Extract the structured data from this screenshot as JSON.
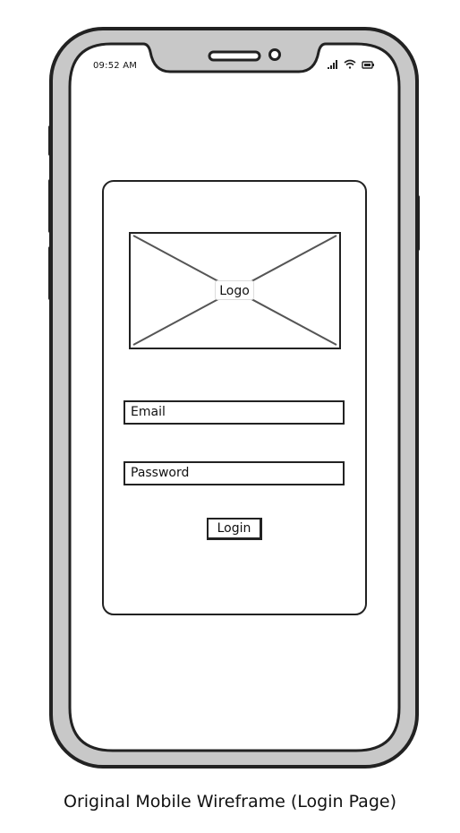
{
  "status_bar": {
    "time": "09:52 AM",
    "icons": [
      "signal-icon",
      "wifi-icon",
      "battery-icon"
    ]
  },
  "login_card": {
    "logo_label": "Logo",
    "email_placeholder": "Email",
    "password_placeholder": "Password",
    "login_label": "Login"
  },
  "caption": "Original Mobile Wireframe (Login Page)",
  "colors": {
    "frame_fill": "#c8c8c8",
    "stroke": "#222222",
    "screen": "#ffffff"
  }
}
